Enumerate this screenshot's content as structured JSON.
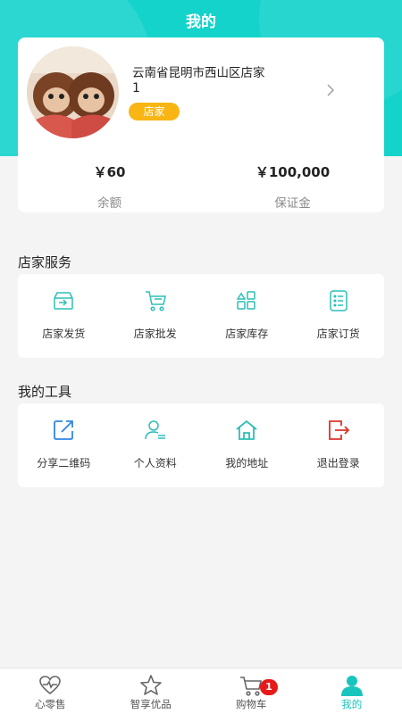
{
  "header": {
    "title": "我的"
  },
  "profile": {
    "shop_name": "云南省昆明市西山区店家",
    "shop_id": "1",
    "role_badge": "店家",
    "balance": {
      "value": "￥60",
      "label": "余额"
    },
    "deposit": {
      "value": "￥100,000",
      "label": "保证金"
    }
  },
  "shop_services": {
    "title": "店家服务",
    "items": [
      {
        "label": "店家发货",
        "icon": "shipping-box-icon"
      },
      {
        "label": "店家批发",
        "icon": "shopping-cart-icon"
      },
      {
        "label": "店家库存",
        "icon": "inventory-grid-icon"
      },
      {
        "label": "店家订货",
        "icon": "order-list-icon"
      }
    ]
  },
  "my_tools": {
    "title": "我的工具",
    "items": [
      {
        "label": "分享二维码",
        "icon": "share-icon"
      },
      {
        "label": "个人资料",
        "icon": "user-profile-icon"
      },
      {
        "label": "我的地址",
        "icon": "home-icon"
      },
      {
        "label": "退出登录",
        "icon": "logout-icon"
      }
    ]
  },
  "tabbar": {
    "items": [
      {
        "label": "心零售",
        "icon": "heart-pulse-icon"
      },
      {
        "label": "智享优品",
        "icon": "star-icon"
      },
      {
        "label": "购物车",
        "icon": "cart-icon"
      },
      {
        "label": "我的",
        "icon": "person-icon"
      }
    ],
    "active_index": 3,
    "cart_badge": "1"
  },
  "colors": {
    "accent": "#14d3cb",
    "badge": "#f8b514",
    "logout": "#d9342b",
    "notification": "#e81919"
  }
}
